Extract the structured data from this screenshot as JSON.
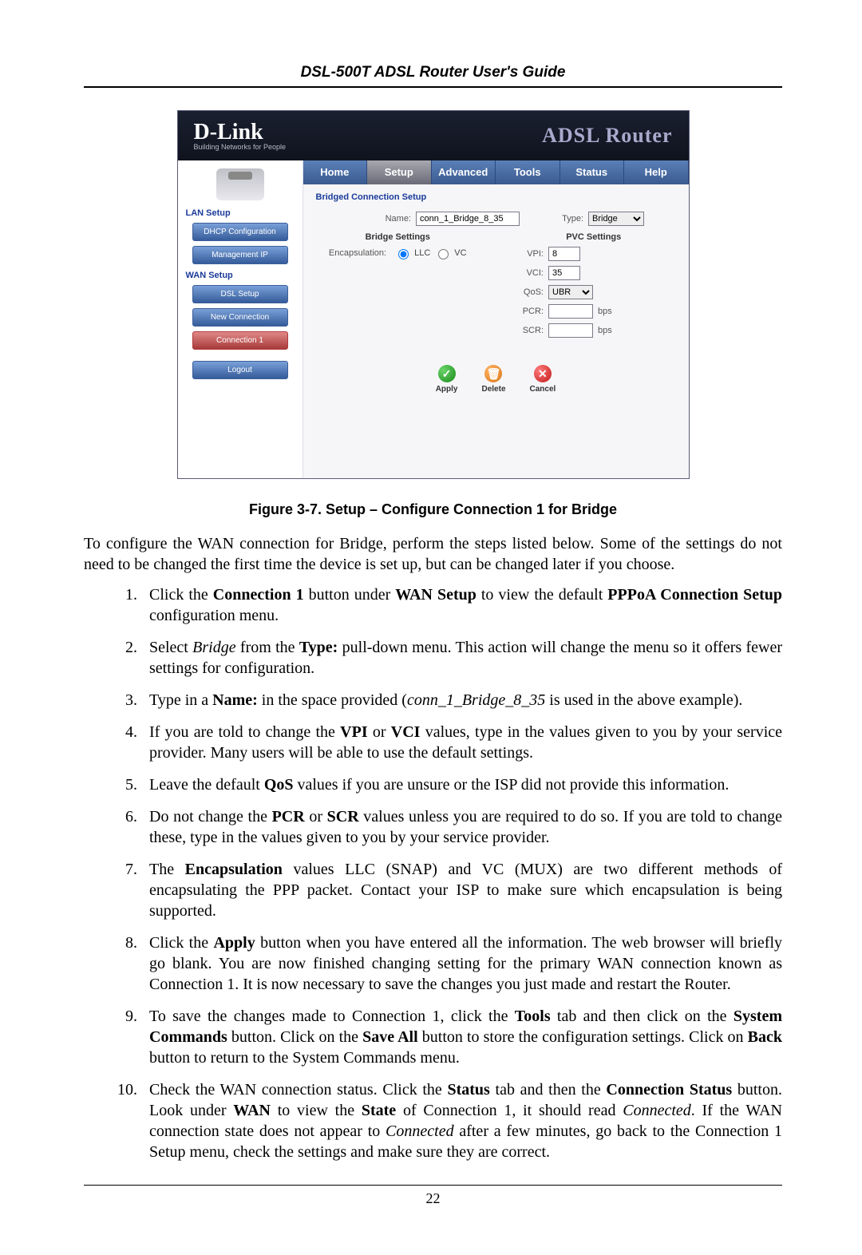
{
  "doc": {
    "header": "DSL-500T ADSL Router User's Guide",
    "figure_caption": "Figure 3-7. Setup – Configure Connection 1 for Bridge",
    "intro_html": "To configure the WAN connection for Bridge, perform the steps listed below. Some of the settings do not need to be changed the first time the device is set up, but can be changed later if you choose.",
    "page_number": "22",
    "steps": [
      "Click the <b>Connection 1</b> button under <b>WAN Setup</b> to view the default <b>PPPoA Connection Setup</b> configuration menu.",
      "Select <i>Bridge</i> from the <b>Type:</b> pull-down menu. This action will change the menu so it offers fewer settings for configuration.",
      "Type in a <b>Name:</b> in the space provided (<i>conn_1_Bridge_8_35</i> is used in the above example).",
      "If you are told to change the <b>VPI</b> or <b>VCI</b> values, type in the values given to you by your service provider. Many users will be able to use the default settings.",
      "Leave the default <b>QoS</b> values if you are unsure or the ISP did not provide this information.",
      "Do not change the <b>PCR</b> or <b>SCR</b> values unless you are required to do so. If you are told to change these, type in the values given to you by your service provider.",
      "The <b>Encapsulation</b> values LLC (SNAP) and VC (MUX) are two different methods of encapsulating the PPP packet. Contact your ISP to make sure which encapsulation is being supported.",
      "Click the <b>Apply</b> button when you have entered all the information. The web browser will briefly go blank. You are now finished changing setting for the primary WAN connection known as Connection 1. It is now necessary to save the changes you just made and restart the Router.",
      "To save the changes made to Connection 1, click the <b>Tools</b> tab and then click on the <b>System Commands</b> button. Click on the <b>Save All</b> button to store the configuration settings. Click on <b>Back</b> button to return to the System Commands menu.",
      "Check the WAN connection status. Click the <b>Status</b> tab and then the <b>Connection Status</b> button. Look under <b>WAN</b> to view the <b>State</b> of Connection 1, it should read <i>Connected</i>. If the WAN connection state does not appear to <i>Connected</i> after a few minutes, go back to the Connection 1 Setup menu, check the settings and make sure they are correct."
    ]
  },
  "ss": {
    "logo_main": "D-Link",
    "logo_sub": "Building Networks for People",
    "product": "ADSL Router",
    "tabs": [
      "Home",
      "Setup",
      "Advanced",
      "Tools",
      "Status",
      "Help"
    ],
    "active_tab": "Setup",
    "sidebar": {
      "group1_label": "LAN Setup",
      "group1_items": [
        "DHCP Configuration",
        "Management IP"
      ],
      "group2_label": "WAN Setup",
      "group2_items": [
        "DSL Setup",
        "New Connection"
      ],
      "group2_active": "Connection 1",
      "logout": "Logout"
    },
    "content": {
      "section_title": "Bridged Connection Setup",
      "name_label": "Name:",
      "name_value": "conn_1_Bridge_8_35",
      "type_label": "Type:",
      "type_value": "Bridge",
      "bridge_settings_title": "Bridge Settings",
      "encap_label": "Encapsulation:",
      "encap_options": [
        "LLC",
        "VC"
      ],
      "encap_selected": "LLC",
      "pvc_settings_title": "PVC Settings",
      "vpi_label": "VPI:",
      "vpi_value": "8",
      "vci_label": "VCI:",
      "vci_value": "35",
      "qos_label": "QoS:",
      "qos_value": "UBR",
      "pcr_label": "PCR:",
      "pcr_value": "",
      "pcr_unit": "bps",
      "scr_label": "SCR:",
      "scr_value": "",
      "scr_unit": "bps",
      "actions": {
        "apply": "Apply",
        "delete": "Delete",
        "cancel": "Cancel"
      }
    }
  }
}
